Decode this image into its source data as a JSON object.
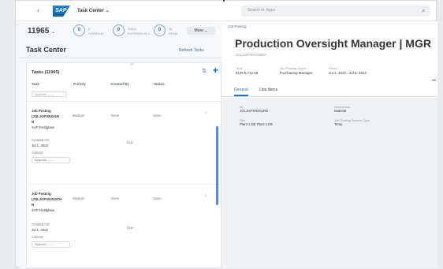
{
  "shell": {
    "back_icon": "chevron-left-icon",
    "logo_text": "SAP",
    "app_title": "Task Center ⌄",
    "search_placeholder": "Search in: Apps",
    "search_icon": "search-icon"
  },
  "left": {
    "total_count": "11965",
    "total_chevron": "⌄",
    "kpis": [
      {
        "icon_text": "0",
        "line1": "0",
        "line2": "OVERDUE"
      },
      {
        "icon_text": "0",
        "line1": "11824",
        "line2": "EXPIRING IN 4..."
      },
      {
        "icon_text": "0",
        "line1": "16",
        "line2": "SPAM"
      }
    ],
    "more_label": "More ⌄",
    "title": "Task Center",
    "refresh_label": "Refresh Tasks",
    "tasks_heading": "Tasks (11965)",
    "columns": [
      "Task",
      "Priority",
      "Created By",
      "Status"
    ],
    "ghost_action": "Approve   ⌄ ⌄",
    "rows": [
      {
        "task_lines": [
          "Job Posting",
          "(JOLJOPXNX01R",
          "N",
          "SAP Fieldglass"
        ],
        "priority": "Medium",
        "created_by": "None",
        "status": "Open",
        "created_on_label": "Created On:",
        "created_on": "Jul 1, 2022",
        "due_label": "Due",
        "actions_label": "Actions:",
        "action": "Approve   ⌄ ⌄"
      },
      {
        "task_lines": [
          "Job Posting",
          "(JOLJOPXNX02CH",
          "N",
          "SAP Fieldglass"
        ],
        "priority": "Medium",
        "created_by": "None",
        "status": "Open",
        "created_on_label": "Created On:",
        "created_on": "Jul 1, 2022",
        "due_label": "Due",
        "actions_label": "Actions:",
        "action": "Approve   ⌄ ⌄"
      }
    ]
  },
  "right": {
    "breadcrumb": "Job Posting",
    "title": "Production Oversight Manager | MGR",
    "subtitle": "JOLJOPXNX01RN",
    "header_attrs": [
      {
        "key": "Total",
        "value": "EUR 5,712.00"
      },
      {
        "key": "Job Posting Owner",
        "value": "Purchasing Manager"
      },
      {
        "key": "Period",
        "value": "Jul 1, 2022 - Jul 8, 2022"
      }
    ],
    "tabs": [
      "General",
      "Line Items"
    ],
    "fields_left": [
      {
        "key": "ID",
        "value": "JOLJOPXNX01RN"
      },
      {
        "key": "Site",
        "value": "Plant 1 DE Plant 1 DE"
      }
    ],
    "fields_right": [
      {
        "key": "Description",
        "value": "Material"
      },
      {
        "key": "Job Posting Service Type",
        "value": "Temp"
      }
    ]
  }
}
